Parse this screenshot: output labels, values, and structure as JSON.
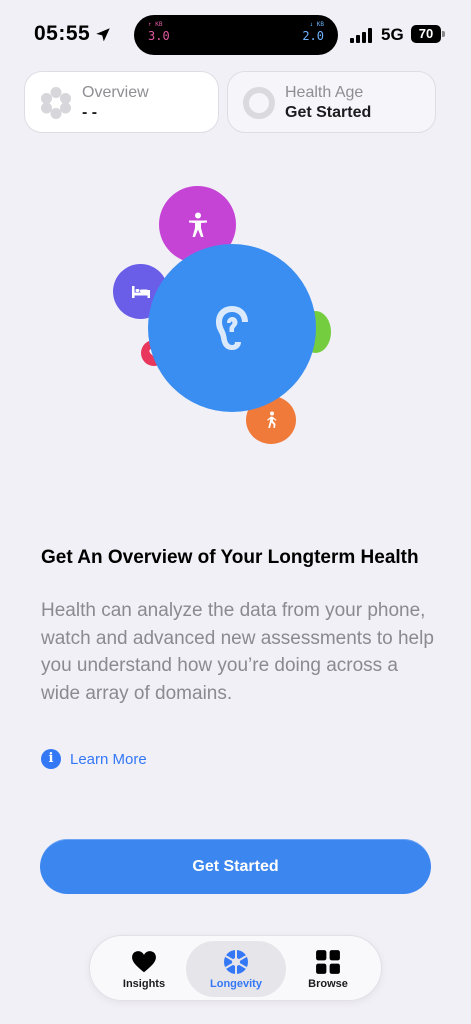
{
  "status_bar": {
    "time": "05:55",
    "upload_arrow": "↑ KB",
    "upload_value": "3.0",
    "download_arrow": "↓ KB",
    "download_value": "2.0",
    "network": "5G",
    "battery": "70"
  },
  "cards": {
    "overview": {
      "title": "Overview",
      "value": "- -"
    },
    "health_age": {
      "title": "Health Age",
      "value": "Get Started"
    }
  },
  "illustration": {
    "bubbles": [
      {
        "name": "body-bubble",
        "icon": "person-figure-icon",
        "color": "#c544d6"
      },
      {
        "name": "sleep-bubble",
        "icon": "bed-icon",
        "color": "#6a5ee8"
      },
      {
        "name": "heart-bubble",
        "icon": "heart-icon",
        "color": "#e8365c"
      },
      {
        "name": "activity-bubble",
        "icon": "walking-icon",
        "color": "#f07a3a"
      },
      {
        "name": "nutrition-bubble",
        "icon": "leaf-icon",
        "color": "#74cc3f"
      },
      {
        "name": "hearing-bubble",
        "icon": "ear-icon",
        "color": "#3b8ef1"
      }
    ]
  },
  "content": {
    "headline": "Get An Overview of Your Longterm Health",
    "description": "Health can analyze the data from your phone, watch and advanced new assessments to help you understand how you’re doing across a wide array of domains.",
    "learn_more": "Learn More"
  },
  "primary_button": {
    "label": "Get Started"
  },
  "tab_bar": {
    "tabs": [
      {
        "label": "Insights",
        "icon": "heart-icon"
      },
      {
        "label": "Longevity",
        "icon": "longevity-icon",
        "selected": true
      },
      {
        "label": "Browse",
        "icon": "grid-icon"
      }
    ]
  },
  "colors": {
    "accent": "#3478f6",
    "background": "#f1f0f6",
    "button": "#3c86f0"
  }
}
